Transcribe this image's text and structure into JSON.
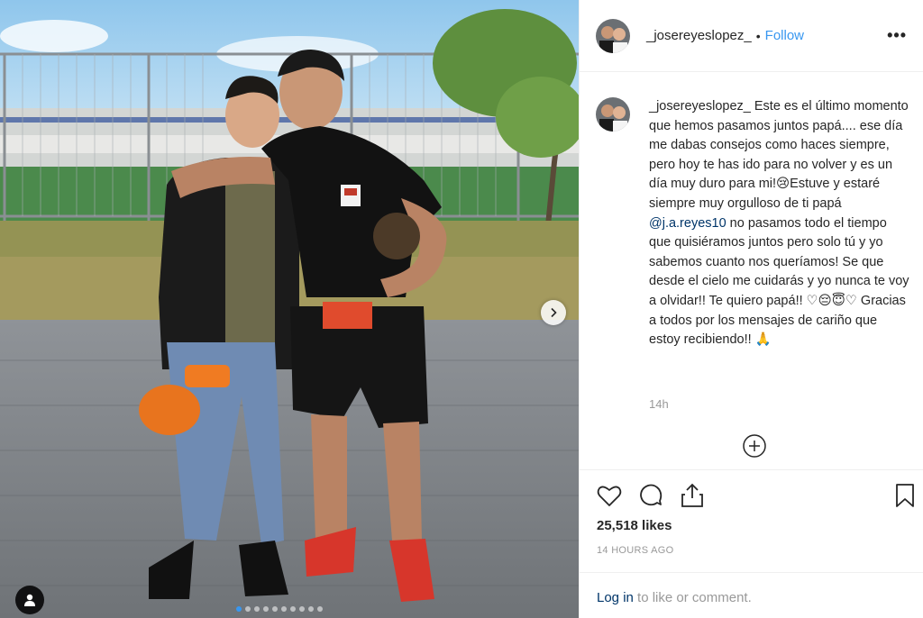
{
  "post": {
    "username": "_josereyeslopez_",
    "follow_label": "Follow",
    "separator": "•",
    "more_label": "•••",
    "caption": {
      "username": "_josereyeslopez_",
      "text_part1": " Este es el último momento que hemos pasamos juntos papá.... ese día me dabas consejos como haces siempre, pero hoy te has ido para no volver y es un día muy duro para mi!😢Estuve y estaré siempre muy orgulloso de ti papá ",
      "mention": "@j.a.reyes10",
      "text_part2": " no pasamos todo el tiempo que quisiéramos juntos pero solo tú y yo sabemos cuanto nos queríamos! Se que desde el cielo me cuidarás y yo nunca te voy a olvidar!! Te quiero papá!! ♡😔😇♡ Gracias a todos por los mensajes de cariño que estoy recibiendo!! 🙏"
    },
    "time_ago": "14h",
    "likes": "25,518 likes",
    "posted_ago": "14 HOURS AGO",
    "login_link": "Log in",
    "login_suffix": " to like or comment."
  },
  "carousel": {
    "dot_count": 10,
    "active_index": 0
  },
  "icons": {
    "next": "chevron-right-icon",
    "user_tag": "user-tag-icon",
    "load_more": "plus-circle-icon",
    "like": "heart-icon",
    "comment": "comment-icon",
    "share": "share-icon",
    "save": "bookmark-icon"
  },
  "colors": {
    "link_blue": "#3897f0",
    "mention_blue": "#003569",
    "muted_gray": "#999999",
    "text": "#262626"
  }
}
